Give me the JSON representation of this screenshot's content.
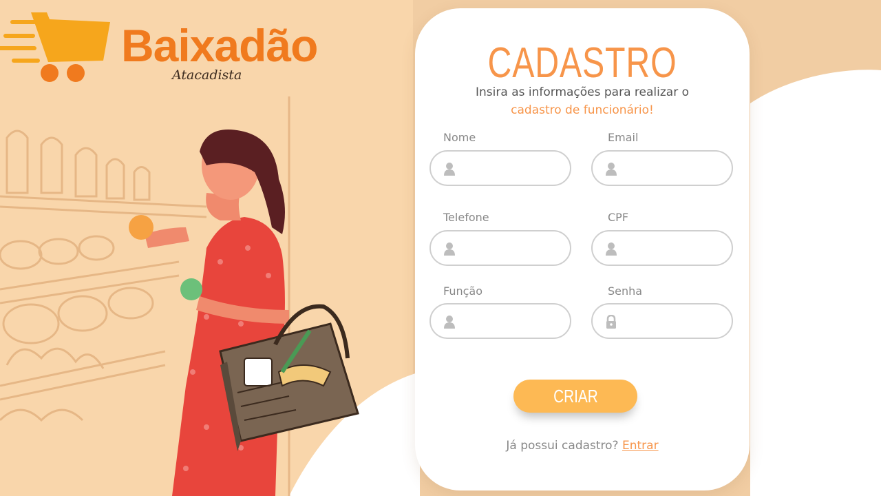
{
  "brand": {
    "name": "Baixadão",
    "tagline": "Atacadista",
    "logo_icon": "shopping-cart-icon",
    "color": "#f07a1e"
  },
  "form": {
    "title": "CADASTRO",
    "subtitle_line1": "Insira as informações para realizar o",
    "subtitle_line2": "cadastro de funcionário!",
    "fields": {
      "nome": {
        "label": "Nome",
        "value": "",
        "icon": "user-icon"
      },
      "email": {
        "label": "Email",
        "value": "",
        "icon": "user-icon"
      },
      "telefone": {
        "label": "Telefone",
        "value": "",
        "icon": "user-icon"
      },
      "cpf": {
        "label": "CPF",
        "value": "",
        "icon": "user-icon"
      },
      "funcao": {
        "label": "Função",
        "value": "",
        "icon": "user-icon"
      },
      "senha": {
        "label": "Senha",
        "value": "",
        "icon": "lock-icon"
      }
    },
    "submit_label": "CRIAR",
    "login_prompt": "Já possui cadastro?",
    "login_link": "Entrar"
  },
  "colors": {
    "background": "#f9d6ab",
    "accent": "#f7954a",
    "button": "#fdb954",
    "card": "#ffffff"
  }
}
